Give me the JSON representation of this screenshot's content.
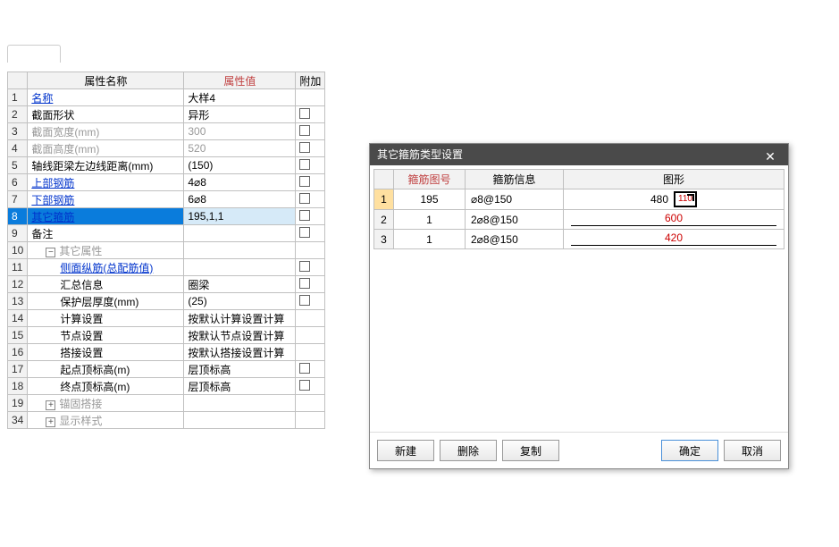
{
  "propTable": {
    "headers": {
      "name": "属性名称",
      "value": "属性值",
      "extra": "附加"
    },
    "rows": [
      {
        "num": "1",
        "name": "名称",
        "value": "大样4",
        "blue": true,
        "showCheckbox": false
      },
      {
        "num": "2",
        "name": "截面形状",
        "value": "异形",
        "showCheckbox": true
      },
      {
        "num": "3",
        "name": "截面宽度(mm)",
        "value": "300",
        "gray": true,
        "showCheckbox": true
      },
      {
        "num": "4",
        "name": "截面高度(mm)",
        "value": "520",
        "gray": true,
        "showCheckbox": true
      },
      {
        "num": "5",
        "name": "轴线距梁左边线距离(mm)",
        "value": "(150)",
        "showCheckbox": true
      },
      {
        "num": "6",
        "name": "上部钢筋",
        "value": "4⌀8",
        "blue": true,
        "showCheckbox": true
      },
      {
        "num": "7",
        "name": "下部钢筋",
        "value": "6⌀8",
        "blue": true,
        "showCheckbox": true
      },
      {
        "num": "8",
        "name": "其它箍筋",
        "value": "195,1,1",
        "blue": true,
        "selected": true,
        "showCheckbox": true
      },
      {
        "num": "9",
        "name": "备注",
        "value": "",
        "showCheckbox": true
      },
      {
        "num": "10",
        "name": "其它属性",
        "value": "",
        "gray": true,
        "group": true,
        "expand": "−"
      },
      {
        "num": "11",
        "name": "侧面纵筋(总配筋值)",
        "value": "",
        "blue": true,
        "indent": 2,
        "showCheckbox": true
      },
      {
        "num": "12",
        "name": "汇总信息",
        "value": "圈梁",
        "indent": 2,
        "showCheckbox": true
      },
      {
        "num": "13",
        "name": "保护层厚度(mm)",
        "value": "(25)",
        "indent": 2,
        "showCheckbox": true
      },
      {
        "num": "14",
        "name": "计算设置",
        "value": "按默认计算设置计算",
        "indent": 2
      },
      {
        "num": "15",
        "name": "节点设置",
        "value": "按默认节点设置计算",
        "indent": 2
      },
      {
        "num": "16",
        "name": "搭接设置",
        "value": "按默认搭接设置计算",
        "indent": 2
      },
      {
        "num": "17",
        "name": "起点顶标高(m)",
        "value": "层顶标高",
        "indent": 2,
        "showCheckbox": true
      },
      {
        "num": "18",
        "name": "终点顶标高(m)",
        "value": "层顶标高",
        "indent": 2,
        "showCheckbox": true
      },
      {
        "num": "19",
        "name": "锚固搭接",
        "value": "",
        "gray": true,
        "group": true,
        "expand": "+"
      },
      {
        "num": "34",
        "name": "显示样式",
        "value": "",
        "gray": true,
        "group": true,
        "expand": "+"
      }
    ]
  },
  "dialog": {
    "title": "其它箍筋类型设置",
    "headers": {
      "num": "箍筋图号",
      "info": "箍筋信息",
      "graphic": "图形"
    },
    "rows": [
      {
        "idx": "1",
        "num": "195",
        "info": "⌀8@150",
        "dim1": "480",
        "dim2": "110",
        "shape": true,
        "selected": true
      },
      {
        "idx": "2",
        "num": "1",
        "info": "2⌀8@150",
        "dim": "600"
      },
      {
        "idx": "3",
        "num": "1",
        "info": "2⌀8@150",
        "dim": "420"
      }
    ],
    "buttons": {
      "new": "新建",
      "delete": "删除",
      "copy": "复制",
      "ok": "确定",
      "cancel": "取消"
    }
  }
}
